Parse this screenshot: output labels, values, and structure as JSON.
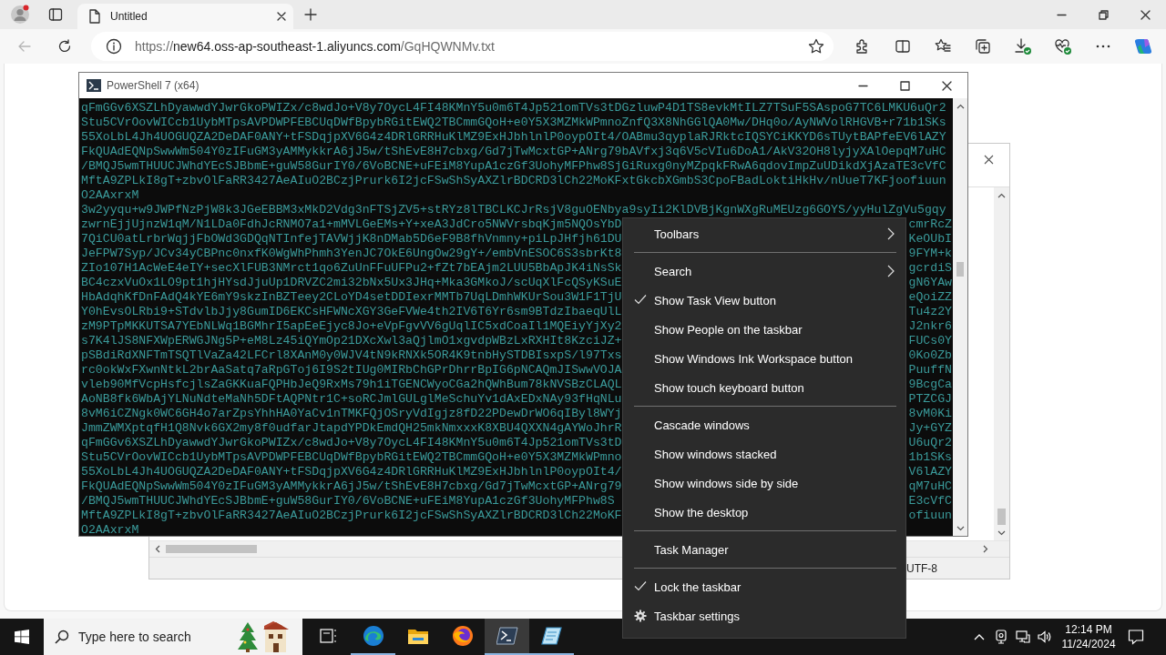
{
  "browser": {
    "tabs": [
      {
        "title": "Untitled",
        "selected": true
      }
    ],
    "back": {
      "disabled": true
    },
    "address": {
      "scheme": "https://",
      "host": "new64.oss-ap-southeast-1.aliyuncs.com",
      "path": "/GqHQWNMv.txt"
    }
  },
  "powershell": {
    "title": "PowerShell 7 (x64)",
    "lines": [
      {
        "text": "qFmGGv6XSZLhDyawwdYJwrGkoPWIZx/c8wdJo+V8y7OycL4FI48KMnY5u0m6T4Jp521omTVs3tDGzluwP4D1TS8evkMtILZ7TSuF5SAspoG7TC6LMKU6uQr2"
      },
      {
        "text": "Stu5CVrOovWICcb1UybMTpsAVPDWPFEBCUqDWfBpybRGitEWQ2TBCmmGQoH+e0Y5X3MZMkWPmnoZnfQ3X8NhGGlQA0Mw/DHq0o/AyNWVolRHGVB+r71b1SKs"
      },
      {
        "text": "55XoLbL4Jh4UOGUQZA2DeDAF0ANY+tFSDqjpXV6G4z4DRlGRRHuKlMZ9ExHJbhlnlP0oypOIt4/OABmu3qyplaRJRktcIQSYCiKKYD6sTUytBAPfeEV6lAZY"
      },
      {
        "text": "FkQUAdEQNpSwwWm504Y0zIFuGM3yAMMykkrA6jJ5w/tShEvE8H7cbxg/Gd7jTwMcxtGP+ANrg79bAVfxj3q6V5cVIu6DoA1/AkV32OH8lyjyXAlOepqM7uHC"
      },
      {
        "text": "/BMQJ5wmTHUUCJWhdYEcSJBbmE+guW58GurIY0/6VoBCNE+uFEiM8YupA1czGf3UohyMFPhw8SjGiRuxg0nyMZpqkFRwA6qdovImpZuUDikdXjAzaTE3cVfC"
      },
      {
        "text": "MftA9ZPLkI8gT+zbvOlFaRR3427AeAIuO2BCzjPrurk6I2jcFSwShSyAXZlrBDCRD3lCh22MoKFxtGkcbXGmbS3CpoFBadLoktiHkHv/nUueT7KFjoofiuun"
      },
      {
        "text": "O2AAxrxM"
      },
      {
        "text": "3w2yyqu+w9JWPfNzPjW8k3JGeEBBM3xMkD2Vdg3nFTSjZV5+stRYz8lTBCLKCJrRsjV8guOENbya9syIi2KlDVBjKgnWXgRuMEUzg6GOYS/yyHulZgVu5gqy"
      },
      {
        "start": "zwrnEjjUjnzW1qM/N1LDa0FdhJcRNMO7a1+mMVLGeEMs+Y+xeA3JdCro5NWVrsbqKjm5NQOsYbD",
        "end": "cmrRcZ"
      },
      {
        "start": "7QiCU0atLrbrWqjjFbOWd3GDQqNTInfejTAVWjjK8nDMab5D6eF9B8fhVnmny+piLpJHfjh61DU",
        "end": "KeOUbI"
      },
      {
        "start": "JeFPW7Syp/JCv34yCBPnc0nxfK0WgWhPhmh3YenJC7OkE6UngOw29gY+/embVnESOC6S3sbrKt8",
        "end": "9FYM+k"
      },
      {
        "start": "ZIo107H1AcWeE4eIY+secXlFUB3NMrct1qo6ZuUnFFuUFPu2+fZt7bEAjm2LUU5BbApJK4iNsSk",
        "end": "gcrdiS"
      },
      {
        "start": "BC4czxVuOx1LO9pt1hjHYsdJjuUp1DRVZC2mi32bNx5Ux3JHq+Mka3GMkoJ/scUqXlFcQSyKSuE",
        "end": "gN6YAw"
      },
      {
        "start": "HbAdqhKfDnFAdQ4kYE6mY9skzInBZTeey2CLoYD4setDDIexrMMTb7UqLDmhWKUrSou3W1F1TjU",
        "end": "eQoiZZ"
      },
      {
        "start": "Y0hEvsOLRbi9+STdvlbJjy8GumID6EKCsHFWNcXGY3GeFVWe4th2IV6T6Yr6sm9BTdzIbaeqUlL",
        "end": "Tu4z2Y"
      },
      {
        "start": "zM9PTpMKKUTSA7YEbNLWq1BGMhrI5apEeEjyc8Jo+eVpFgvVV6gUqlIC5xdCoaIl1MQEiyYjXy2",
        "end": "J2nkr6"
      },
      {
        "start": "s7K4lJS8NFXWpERWGJNg5P+eM8Lz45iQYmOp21DXcXwl3aQjlmO1xgvdpWBzLxRXHIt8KzciJZ+",
        "end": "FUCs0Y"
      },
      {
        "start": "pSBdiRdXNFTmTSQTlVaZa42LFCrl8XAnM0y0WJV4tN9kRNXk5OR4K9tnbHySTDBIsxpS/l97Txs",
        "end": "0Ko0Zb"
      },
      {
        "start": "rc0okWxFXwnNtkL2brAaSatq7aRpGToj6I9S2tIUg0MIRbChGPrDhrrBpIG6pNCAQmJISwwVOJA",
        "end": "PuuffN"
      },
      {
        "start": "vleb90MfVcpHsfcjlsZaGKKuaFQPHbJeQ9RxMs79h1iTGENCWyoCGa2hQWhBum78kNVSBzCLAQL",
        "end": "9BcgCa"
      },
      {
        "start": "AoNB8fk6WbAjYLNuNdteMaNh5DFtAQPNtr1C+soRCJmlGULglMeSchuYv1dAxEDxNAy93fHqNLu",
        "end": "PTZCGJ"
      },
      {
        "start": "8vM6iCZNgk0WC6GH4o7arZpsYhhHA0YaCv1nTMKFQjOSryVdIgjz8fD22PDewDrWO6qIByl8WYj",
        "end": "8vM0Ki"
      },
      {
        "start": "JmmZWMXptqfH1Q8Nvk6GX2my8f0udfarJtapdYPDkEmdQH25mkNmxxxK8XBU4QXXN4gAYWoJhrR",
        "end": "Jy+GYZ"
      },
      {
        "start": "qFmGGv6XSZLhDyawwdYJwrGkoPWIZx/c8wdJo+V8y7OycL4FI48KMnY5u0m6T4Jp521omTVs3tD",
        "end": "U6uQr2"
      },
      {
        "start": "Stu5CVrOovWICcb1UybMTpsAVPDWPFEBCUqDWfBpybRGitEWQ2TBCmmGQoH+e0Y5X3MZMkWPmno",
        "end": "1b1SKs"
      },
      {
        "start": "55XoLbL4Jh4UOGUQZA2DeDAF0ANY+tFSDqjpXV6G4z4DRlGRRHuKlMZ9ExHJbhlnlP0oypOIt4/",
        "end": "V6lAZY"
      },
      {
        "start": "FkQUAdEQNpSwwWm504Y0zIFuGM3yAMMykkrA6jJ5w/tShEvE8H7cbxg/Gd7jTwMcxtGP+ANrg79",
        "end": "qM7uHC"
      },
      {
        "start": "/BMQJ5wmTHUUCJWhdYEcSJBbmE+guW58GurIY0/6VoBCNE+uFEiM8YupA1czGf3UohyMFPhw8S",
        "end": "E3cVfC"
      },
      {
        "start": "MftA9ZPLkI8gT+zbvOlFaRR3427AeAIuO2BCzjPrurk6I2jcFSwShSyAXZlrBDCRD3lCh22MoKF",
        "end": "ofiuun"
      },
      {
        "text": "O2AAxrxM"
      }
    ]
  },
  "background_window": {
    "status": "UTF-8"
  },
  "context_menu": {
    "items": [
      {
        "kind": "submenu",
        "label": "Toolbars"
      },
      {
        "kind": "separator"
      },
      {
        "kind": "submenu",
        "label": "Search"
      },
      {
        "kind": "toggle",
        "label": "Show Task View button",
        "checked": true
      },
      {
        "kind": "toggle",
        "label": "Show People on the taskbar",
        "checked": false
      },
      {
        "kind": "toggle",
        "label": "Show Windows Ink Workspace button",
        "checked": false
      },
      {
        "kind": "toggle",
        "label": "Show touch keyboard button",
        "checked": false
      },
      {
        "kind": "separator"
      },
      {
        "kind": "action",
        "label": "Cascade windows"
      },
      {
        "kind": "action",
        "label": "Show windows stacked"
      },
      {
        "kind": "action",
        "label": "Show windows side by side"
      },
      {
        "kind": "action",
        "label": "Show the desktop"
      },
      {
        "kind": "separator"
      },
      {
        "kind": "action",
        "label": "Task Manager"
      },
      {
        "kind": "separator"
      },
      {
        "kind": "toggle",
        "label": "Lock the taskbar",
        "checked": true
      },
      {
        "kind": "settings",
        "label": "Taskbar settings"
      }
    ]
  },
  "taskbar": {
    "search": {
      "placeholder": "Type here to search"
    },
    "apps": [
      {
        "kind": "task-view",
        "running": false,
        "active": false
      },
      {
        "kind": "edge",
        "running": true,
        "active": false
      },
      {
        "kind": "explorer",
        "running": false,
        "active": false
      },
      {
        "kind": "firefox",
        "running": false,
        "active": false
      },
      {
        "kind": "terminal",
        "running": true,
        "active": true
      },
      {
        "kind": "notepad",
        "running": true,
        "active": false
      }
    ],
    "clock": {
      "time": "12:14 PM",
      "date": "11/24/2024"
    }
  }
}
